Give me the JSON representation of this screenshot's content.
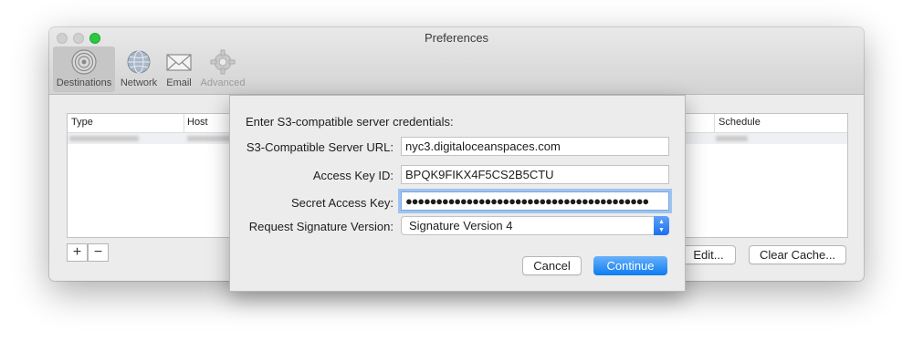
{
  "window": {
    "title": "Preferences",
    "toolbar": [
      {
        "label": "Destinations",
        "icon": "destinations-target-icon",
        "selected": true
      },
      {
        "label": "Network",
        "icon": "globe-icon"
      },
      {
        "label": "Email",
        "icon": "envelope-icon"
      },
      {
        "label": "Advanced",
        "icon": "gear-icon",
        "disabled": true
      }
    ]
  },
  "table": {
    "headers": {
      "type": "Type",
      "host": "Host",
      "schedule": "Schedule"
    }
  },
  "buttons": {
    "add": "+",
    "remove": "−",
    "edit": "Edit...",
    "clear_cache": "Clear Cache..."
  },
  "sheet": {
    "title": "Enter S3-compatible server credentials:",
    "url_label": "S3-Compatible Server URL:",
    "url_value": "nyc3.digitaloceanspaces.com",
    "access_key_label": "Access Key ID:",
    "access_key_value": "BPQK9FIKX4F5CS2B5CTU",
    "secret_label": "Secret Access Key:",
    "secret_value": "●●●●●●●●●●●●●●●●●●●●●●●●●●●●●●●●●●●●●●●●",
    "signature_label": "Request Signature Version:",
    "signature_value": "Signature Version 4",
    "cancel": "Cancel",
    "continue": "Continue"
  },
  "colors": {
    "accent": "#1b6ff0",
    "zoom_button": "#2bc840",
    "focus_ring": "#9fc3ef"
  }
}
